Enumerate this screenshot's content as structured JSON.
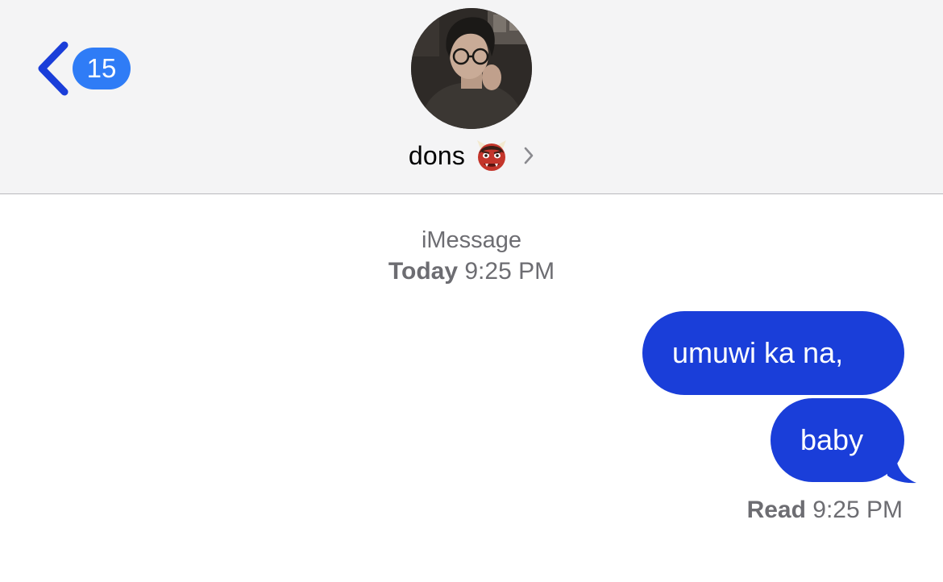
{
  "header": {
    "back_badge_count": "15",
    "contact_name": "dons",
    "contact_emoji_icon": "ogre-emoji",
    "back_icon": "chevron-left-icon",
    "details_icon": "chevron-right-icon"
  },
  "thread": {
    "service": "iMessage",
    "date_label": "Today",
    "date_time": "9:25 PM",
    "messages": [
      {
        "direction": "outgoing",
        "text": "umuwi ka na,"
      },
      {
        "direction": "outgoing",
        "text": "baby"
      }
    ],
    "read_label": "Read",
    "read_time": "9:25 PM"
  },
  "colors": {
    "accent": "#2f7cf6",
    "bubble": "#1a3ed9",
    "header_bg": "#f4f4f5",
    "secondary_text": "#6d6d72"
  }
}
